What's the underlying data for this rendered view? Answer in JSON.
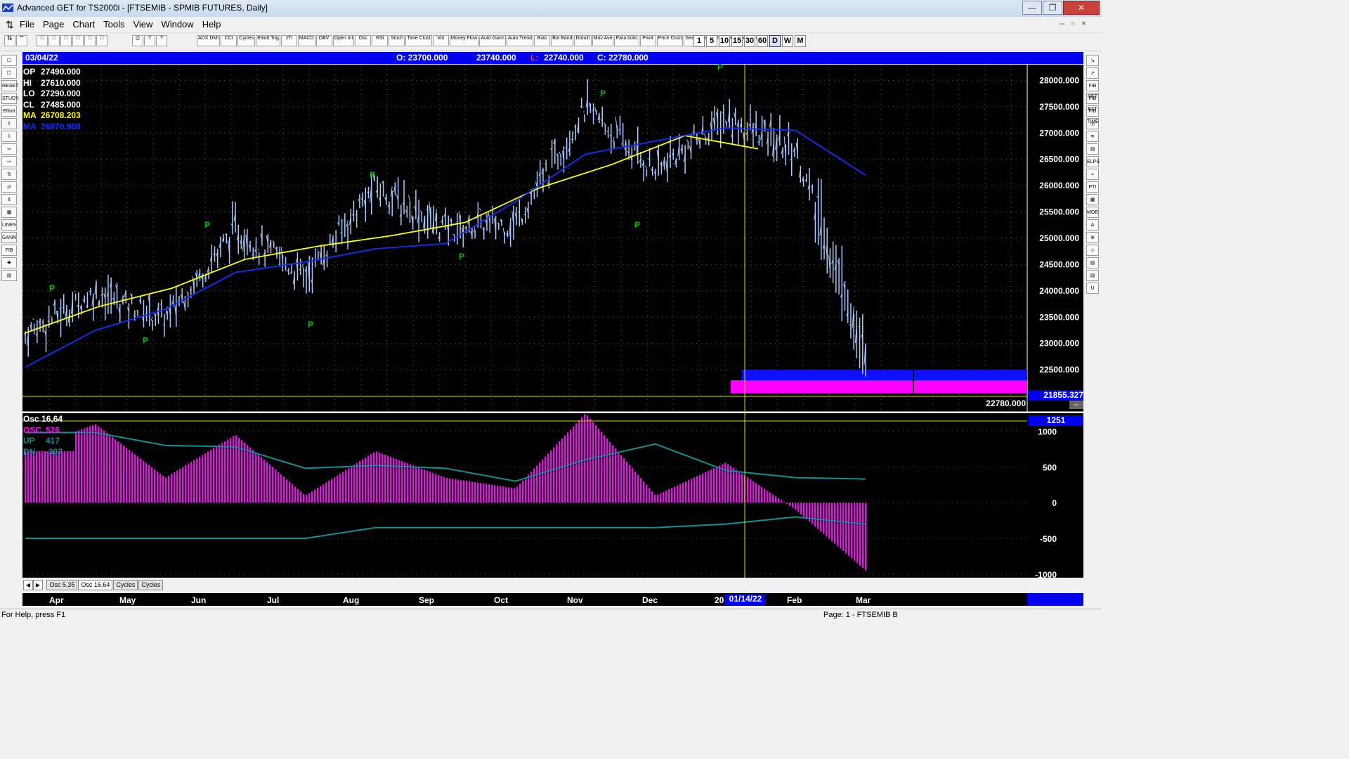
{
  "window": {
    "title": "Advanced GET for TS2000i - [FTSEMIB - SPMIB FUTURES, Daily]",
    "controls": [
      "—",
      "❐",
      "✕"
    ],
    "mdi_controls": [
      "–",
      "▫",
      "×"
    ]
  },
  "menu": [
    "File",
    "Page",
    "Chart",
    "Tools",
    "View",
    "Window",
    "Help"
  ],
  "toolbar": {
    "file_buttons": [
      "□",
      "□",
      "□",
      "□",
      "□",
      "□",
      "?",
      "?"
    ],
    "indicator_buttons": [
      "ADX DMI",
      "CCI",
      "Cycles",
      "Elliott Trig",
      "JTI",
      "MACD",
      "OBV",
      "Open Int",
      "Osc",
      "RSI",
      "Stoch",
      "Time Clust",
      "Vol",
      "Money Flow",
      "Auto Gann",
      "Auto Trend",
      "Bias",
      "Bol Band",
      "Donch",
      "Mov Ave",
      "Para bolic",
      "Pivot",
      "Price Clust",
      "Seas onals",
      "TJ's Web",
      "Trade Profile",
      "XTL"
    ],
    "timeframes": [
      "1",
      "5",
      "10",
      "15",
      "30",
      "60",
      "D",
      "W",
      "M"
    ],
    "active_timeframe": "D"
  },
  "left_tools": [
    "☐",
    "☐",
    "RESET",
    "STUDY",
    "Elliott",
    "⇧",
    "⇩",
    "⇦",
    "⇨",
    "⇅",
    "⇄",
    "⇕",
    "▦",
    "LINES",
    "GANN",
    "FIB",
    "✚",
    "▤"
  ],
  "right_tools": [
    "↘",
    "↗",
    "FIB RET",
    "FIB EXT",
    "FIB TIME",
    "◎",
    "≋",
    "▤",
    "ELPS",
    "≈",
    "PTI",
    "▦",
    "MOB",
    "A",
    "⊕",
    "◇",
    "▤",
    "▤",
    "U"
  ],
  "infobar": {
    "date": "03/04/22",
    "open": "O: 23700.000",
    "high": "23740.000",
    "low_label": "L:",
    "low": "22740.000",
    "close": "C: 22780.000"
  },
  "price_panel": {
    "overlay": [
      {
        "label": "OP",
        "value": "27490.000",
        "color": "#ffffff"
      },
      {
        "label": "HI",
        "value": "27610.000",
        "color": "#ffffff"
      },
      {
        "label": "LO",
        "value": "27290.000",
        "color": "#ffffff"
      },
      {
        "label": "CL",
        "value": "27485.000",
        "color": "#ffffff"
      },
      {
        "label": "MA",
        "value": "26708.203",
        "color": "#ffff00"
      },
      {
        "label": "MA",
        "value": "26870.908",
        "color": "#1030ff"
      }
    ],
    "price_labels": [
      "28000.000",
      "27500.000",
      "27000.000",
      "26500.000",
      "26000.000",
      "25500.000",
      "25000.000",
      "24500.000",
      "24000.000",
      "23500.000",
      "23000.000",
      "22500.000",
      "22000.000"
    ],
    "cursor_price": "21855.327",
    "last_price": "22780.000",
    "pivot_marker": "P"
  },
  "osc_panel": {
    "header": "Osc 16,64",
    "lines": [
      {
        "label": "OSC",
        "value": "526",
        "color": "#ff00ff"
      },
      {
        "label": "UP",
        "value": "417",
        "color": "#109090"
      },
      {
        "label": "DN",
        "value": "-307",
        "color": "#109090"
      }
    ],
    "labels": [
      "1000",
      "500",
      "0",
      "-500",
      "-1000"
    ],
    "cursor_value": "1251"
  },
  "tabs": [
    "Osc 5,35",
    "Osc 16,64",
    "Cycles",
    "Cycles"
  ],
  "active_tab": "Osc 16,64",
  "x_axis": {
    "months": [
      "Apr",
      "May",
      "Jun",
      "Jul",
      "Aug",
      "Sep",
      "Oct",
      "Nov",
      "Dec",
      "20",
      "Feb",
      "Mar"
    ],
    "cursor_date": "01/14/22"
  },
  "status": {
    "help": "For Help, press F1",
    "page": "Page: 1 - FTSEMIB B"
  },
  "colors": {
    "chart_bg": "#000000",
    "info_bar": "#0000f0",
    "ma_fast": "#ffff00",
    "ma_slow": "#1030ff",
    "osc": "#ff00ff",
    "bands": "#109090",
    "pivot": "#00c000",
    "bars": "#a8c8ff"
  },
  "chart_data": [
    {
      "type": "candlestick",
      "title": "FTSEMIB - SPMIB FUTURES, Daily",
      "ylim": [
        21700,
        28300
      ],
      "x": [
        "Mar",
        "Apr",
        "May",
        "Jun",
        "Jul",
        "Aug",
        "Sep",
        "Oct",
        "Nov",
        "Dec",
        "Jan",
        "Feb",
        "Mar"
      ],
      "close": [
        23200,
        24000,
        23500,
        25200,
        24300,
        26000,
        25200,
        25300,
        27500,
        26300,
        27300,
        26700,
        22780
      ],
      "series": [
        {
          "name": "MA 26708.203",
          "values": [
            23200,
            23700,
            24050,
            24600,
            24850,
            25050,
            25300,
            25950,
            26400,
            26950,
            26700
          ]
        },
        {
          "name": "MA 26870.908",
          "values": [
            22550,
            23250,
            23650,
            24350,
            24550,
            24800,
            24900,
            25700,
            26600,
            26850,
            27100,
            27050,
            26200
          ]
        }
      ],
      "pivots": [
        {
          "x": "Apr",
          "value": 24000,
          "label": "P"
        },
        {
          "x": "May",
          "value": 23000,
          "label": "P"
        },
        {
          "x": "Jun",
          "value": 25200,
          "label": "P"
        },
        {
          "x": "Jul",
          "value": 23300,
          "label": "P"
        },
        {
          "x": "Aug",
          "value": 26150,
          "label": "P"
        },
        {
          "x": "Sep",
          "value": 24600,
          "label": "P"
        },
        {
          "x": "Nov",
          "value": 27700,
          "label": "P"
        },
        {
          "x": "Dec",
          "value": 25200,
          "label": "P"
        },
        {
          "x": "Jan",
          "value": 28200,
          "label": "P"
        }
      ],
      "zones": [
        {
          "color": "#1010ff",
          "from": 22300,
          "to": 22500
        },
        {
          "color": "#ff00ff",
          "from": 22050,
          "to": 22300
        }
      ]
    },
    {
      "type": "bar",
      "title": "Osc 16,64",
      "ylim": [
        -1050,
        1250
      ],
      "categories": [
        "Mar",
        "Apr",
        "May",
        "Jun",
        "Jul",
        "Aug",
        "Sep",
        "Oct",
        "Nov",
        "Dec",
        "Jan",
        "Feb",
        "Mar"
      ],
      "values": [
        720,
        1100,
        350,
        950,
        100,
        720,
        350,
        200,
        1250,
        100,
        560,
        -100,
        -950
      ],
      "series": [
        {
          "name": "UP",
          "values": [
            980,
            980,
            800,
            780,
            480,
            520,
            480,
            300,
            600,
            820,
            450,
            350,
            330
          ]
        },
        {
          "name": "DN",
          "values": [
            -500,
            -500,
            -500,
            -500,
            -500,
            -350,
            -350,
            -350,
            -350,
            -350,
            -300,
            -200,
            -300
          ]
        }
      ]
    }
  ]
}
